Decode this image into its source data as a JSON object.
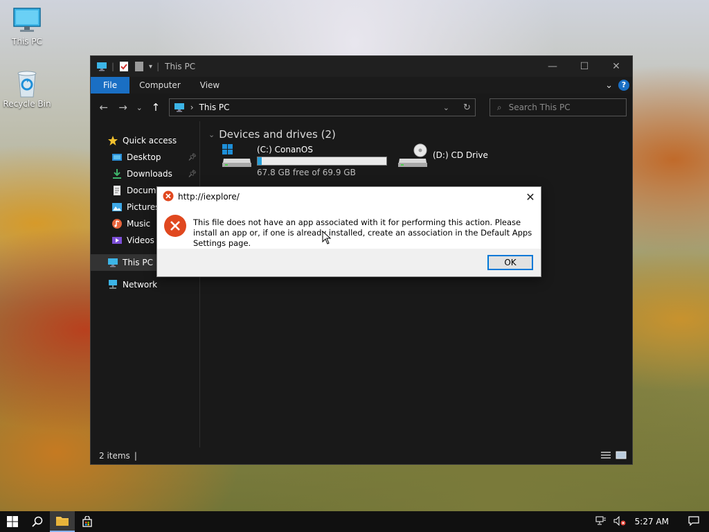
{
  "desktop": {
    "icons": [
      {
        "label": "This PC"
      },
      {
        "label": "Recycle Bin"
      }
    ]
  },
  "explorer": {
    "title": "This PC",
    "ribbon_tabs": [
      "File",
      "Computer",
      "View"
    ],
    "address": "This PC",
    "search_placeholder": "Search This PC",
    "nav": {
      "quick_access": "Quick access",
      "desktop": "Desktop",
      "downloads": "Downloads",
      "documents": "Docume",
      "pictures": "Pictures",
      "music": "Music",
      "videos": "Videos",
      "this_pc": "This PC",
      "network": "Network"
    },
    "group_header": "Devices and drives (2)",
    "drives": [
      {
        "name": "(C:) ConanOS",
        "free": "67.8 GB free of 69.9 GB",
        "used_fraction": 0.03
      },
      {
        "name": "(D:) CD Drive"
      }
    ],
    "status": "2 items"
  },
  "dialog": {
    "title": "http://iexplore/",
    "message": "This file does not have an app associated with it for performing this action. Please install an app or, if one is already installed, create an association in the Default Apps Settings page.",
    "ok_label": "OK"
  },
  "taskbar": {
    "time": "5:27 AM"
  },
  "colors": {
    "accent": "#1a6fc4",
    "error": "#e0481f",
    "progress": "#26a0da"
  }
}
